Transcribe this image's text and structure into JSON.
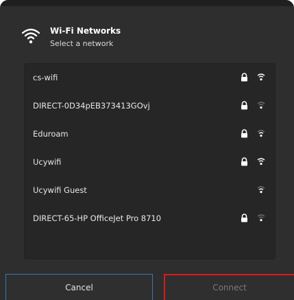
{
  "dialog": {
    "title": "Wi-Fi Networks",
    "subtitle": "Select a network",
    "header_icon": "wifi-icon"
  },
  "networks": [
    {
      "name": "cs-wifi",
      "secured": true,
      "signal": "strong"
    },
    {
      "name": "DIRECT-0D34pEB373413GOvj",
      "secured": true,
      "signal": "weak"
    },
    {
      "name": "Eduroam",
      "secured": true,
      "signal": "weak"
    },
    {
      "name": "Ucywifi",
      "secured": true,
      "signal": "strong"
    },
    {
      "name": "Ucywifi Guest",
      "secured": false,
      "signal": "weak"
    },
    {
      "name": "DIRECT-65-HP OfficeJet Pro 8710",
      "secured": true,
      "signal": "weak"
    }
  ],
  "buttons": {
    "cancel": "Cancel",
    "connect": "Connect"
  },
  "colors": {
    "dialog_bg": "#2e2e2e",
    "list_bg": "#262626",
    "focus_border": "#3a76b8",
    "highlight_red": "#e01818",
    "disabled_text": "#7a7a7a"
  }
}
